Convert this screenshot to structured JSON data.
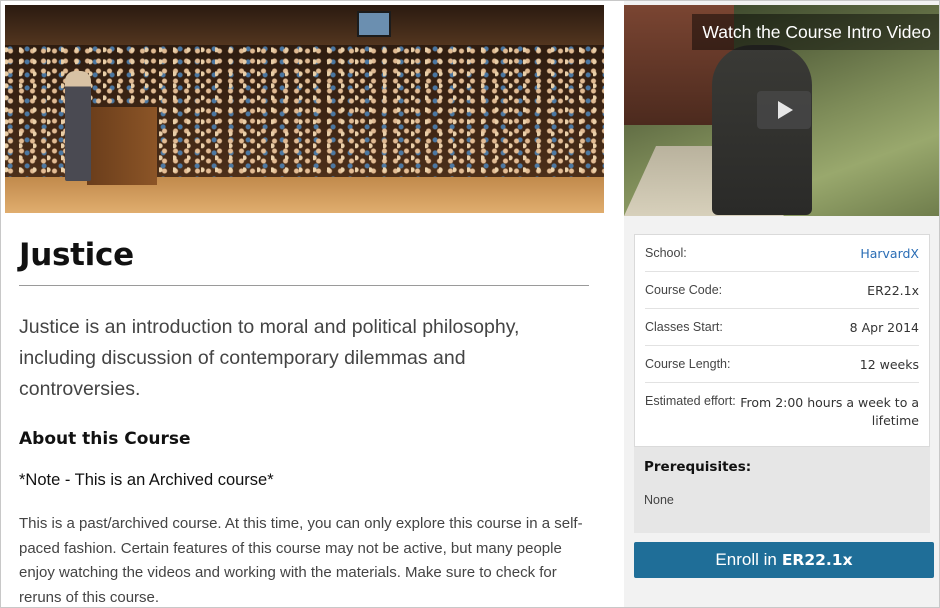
{
  "course": {
    "title": "Justice",
    "subtitle": "Justice is an introduction to moral and political philosophy, including discussion of contemporary dilemmas and controversies.",
    "about_heading": "About this Course",
    "note": "*Note - This is an Archived course*",
    "body": "This is a past/archived course. At this time, you can only explore this course in a self-paced fashion. Certain features of this course may not be active, but many people enjoy watching the videos and working with the materials. Make sure to check for reruns of this course."
  },
  "video": {
    "title": "Watch the Course Intro Video"
  },
  "facts": {
    "school_label": "School:",
    "school_value": "HarvardX",
    "code_label": "Course Code:",
    "code_value": "ER22.1x",
    "start_label": "Classes Start:",
    "start_value": "8 Apr 2014",
    "length_label": "Course Length:",
    "length_value": "12 weeks",
    "effort_label": "Estimated effort:",
    "effort_value": "From 2:00 hours a week to a lifetime"
  },
  "prerequisites": {
    "title": "Prerequisites:",
    "value": "None"
  },
  "enroll": {
    "prefix": "Enroll in",
    "code": "ER22.1x"
  },
  "colors": {
    "link": "#2a6db5",
    "enroll_button": "#1f6e98",
    "sidebar_bg": "#f2f2f2"
  }
}
